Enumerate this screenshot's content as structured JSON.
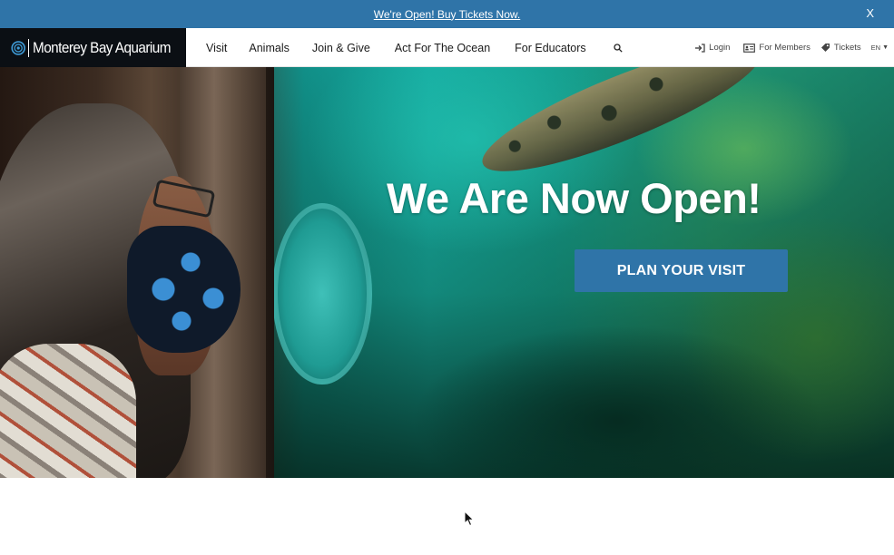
{
  "announcement": {
    "link_text": "We're Open! Buy Tickets Now.",
    "close_label": "X"
  },
  "header": {
    "logo_text": "Monterey Bay Aquarium",
    "nav": [
      {
        "label": "Visit"
      },
      {
        "label": "Animals"
      },
      {
        "label": "Join & Give"
      },
      {
        "label": "Act For The Ocean"
      },
      {
        "label": "For Educators"
      }
    ],
    "search_icon": "search-icon",
    "utility": {
      "login": "Login",
      "members": "For Members",
      "tickets": "Tickets",
      "language": "EN"
    }
  },
  "hero": {
    "title": "We Are Now Open!",
    "cta_label": "PLAN YOUR VISIT"
  },
  "colors": {
    "brand_blue": "#2f74a8",
    "logo_bg": "#0b0f14"
  }
}
